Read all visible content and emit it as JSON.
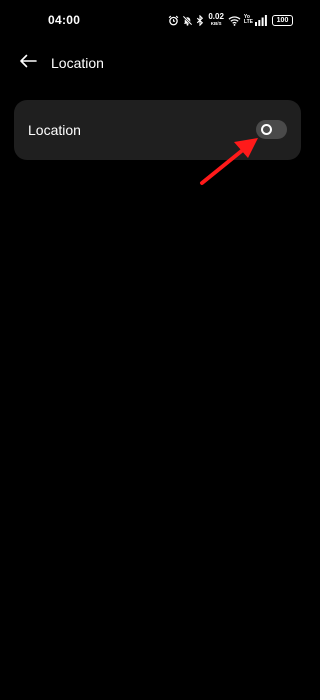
{
  "status_bar": {
    "time": "04:00",
    "net_speed_value": "0.02",
    "net_speed_unit": "KB/S",
    "volte_line1": "Yo",
    "volte_line2": "LTE",
    "battery": "100"
  },
  "header": {
    "title": "Location",
    "back_icon": "arrow-left-icon"
  },
  "settings": {
    "location_label": "Location",
    "location_enabled": false
  },
  "colors": {
    "background": "#000000",
    "card": "#1f1f1f",
    "toggle_off_track": "#4a4a4a",
    "annotation_arrow": "#ff1a1a"
  }
}
